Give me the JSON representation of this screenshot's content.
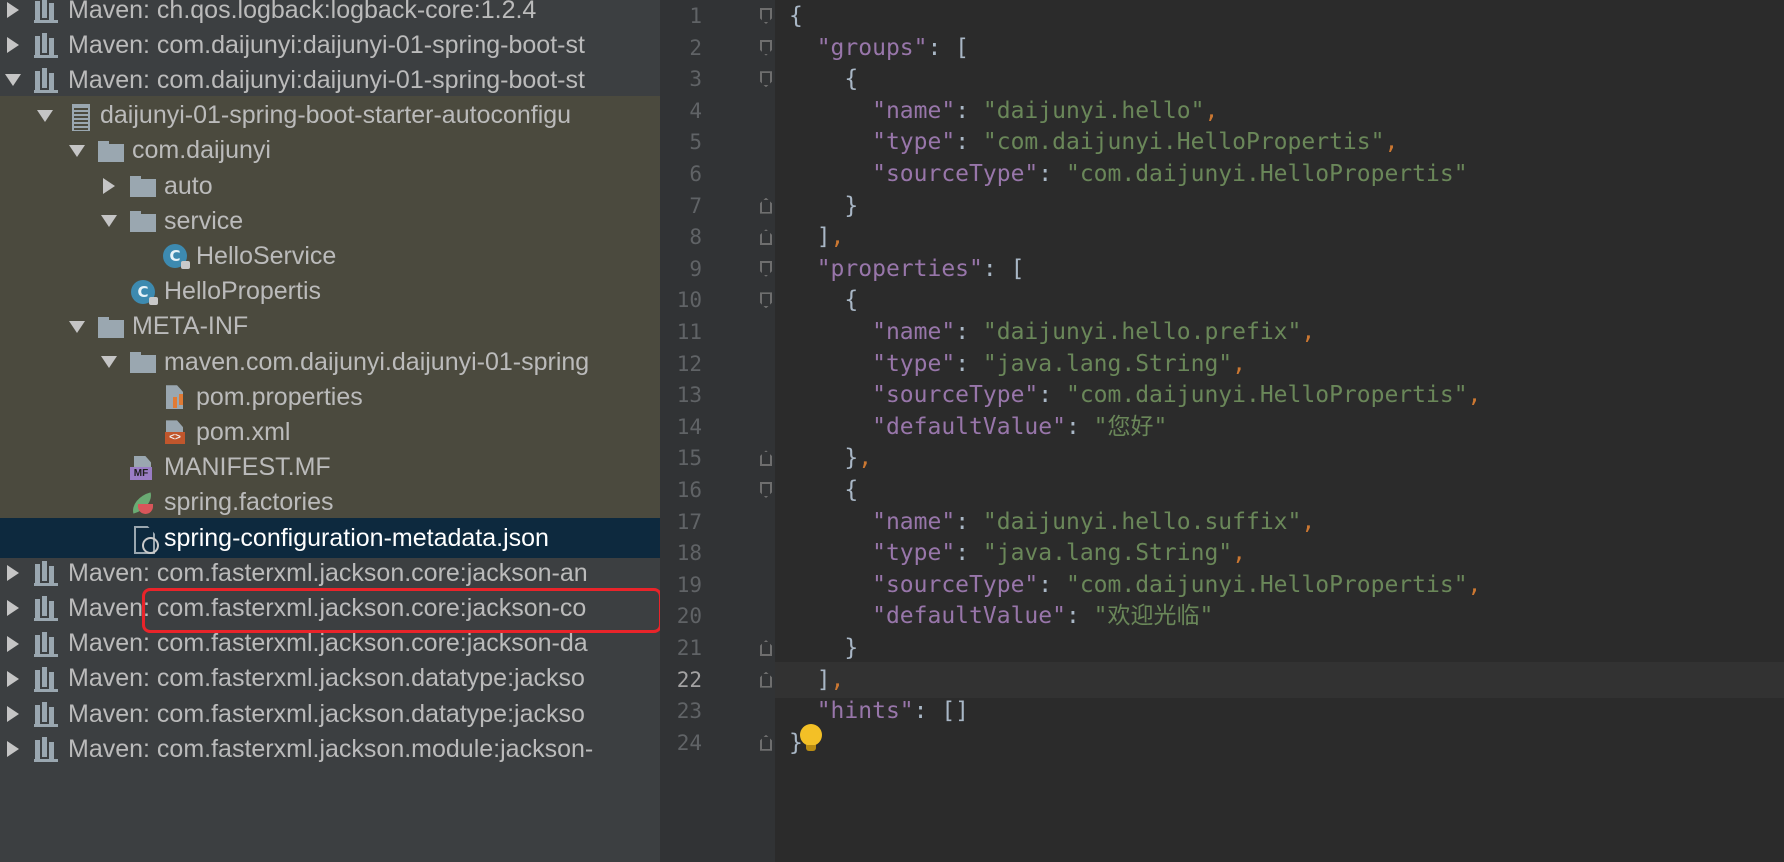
{
  "project_tree": {
    "rows": [
      {
        "label": "Maven: ch.qos.logback:logback-core:1.2.4",
        "indent": 0,
        "arrow": "right",
        "icon": "library-icon"
      },
      {
        "label": "Maven: com.daijunyi:daijunyi-01-spring-boot-st",
        "indent": 0,
        "arrow": "right",
        "icon": "library-icon"
      },
      {
        "label": "Maven: com.daijunyi:daijunyi-01-spring-boot-st",
        "indent": 0,
        "arrow": "down",
        "icon": "library-icon"
      },
      {
        "label": "daijunyi-01-spring-boot-starter-autoconfigu",
        "indent": 1,
        "arrow": "down",
        "icon": "jar-icon"
      },
      {
        "label": "com.daijunyi",
        "indent": 2,
        "arrow": "down",
        "icon": "package-icon"
      },
      {
        "label": "auto",
        "indent": 3,
        "arrow": "right",
        "icon": "package-icon"
      },
      {
        "label": "service",
        "indent": 3,
        "arrow": "down",
        "icon": "package-icon"
      },
      {
        "label": "HelloService",
        "indent": 4,
        "arrow": "none",
        "icon": "class-icon"
      },
      {
        "label": "HelloPropertis",
        "indent": 3,
        "arrow": "none",
        "icon": "class-icon"
      },
      {
        "label": "META-INF",
        "indent": 2,
        "arrow": "down",
        "icon": "folder-icon"
      },
      {
        "label": "maven.com.daijunyi.daijunyi-01-spring",
        "indent": 3,
        "arrow": "down",
        "icon": "folder-icon"
      },
      {
        "label": "pom.properties",
        "indent": 4,
        "arrow": "none",
        "icon": "properties-file-icon"
      },
      {
        "label": "pom.xml",
        "indent": 4,
        "arrow": "none",
        "icon": "xml-file-icon"
      },
      {
        "label": "MANIFEST.MF",
        "indent": 3,
        "arrow": "none",
        "icon": "manifest-file-icon"
      },
      {
        "label": "spring.factories",
        "indent": 3,
        "arrow": "none",
        "icon": "spring-file-icon"
      },
      {
        "label": "spring-configuration-metadata.json",
        "indent": 3,
        "arrow": "none",
        "icon": "json-file-icon",
        "selected": true
      },
      {
        "label": "Maven: com.fasterxml.jackson.core:jackson-an",
        "indent": 0,
        "arrow": "right",
        "icon": "library-icon"
      },
      {
        "label": "Maven: com.fasterxml.jackson.core:jackson-co",
        "indent": 0,
        "arrow": "right",
        "icon": "library-icon"
      },
      {
        "label": "Maven: com.fasterxml.jackson.core:jackson-da",
        "indent": 0,
        "arrow": "right",
        "icon": "library-icon"
      },
      {
        "label": "Maven: com.fasterxml.jackson.datatype:jackso",
        "indent": 0,
        "arrow": "right",
        "icon": "library-icon"
      },
      {
        "label": "Maven: com.fasterxml.jackson.datatype:jackso",
        "indent": 0,
        "arrow": "right",
        "icon": "library-icon"
      },
      {
        "label": "Maven: com.fasterxml.jackson.module:jackson-",
        "indent": 0,
        "arrow": "right",
        "icon": "library-icon"
      }
    ]
  },
  "editor": {
    "current_line": 22,
    "lines": [
      {
        "n": "1",
        "fold": "open",
        "tokens": [
          {
            "t": "{",
            "c": ""
          }
        ]
      },
      {
        "n": "2",
        "fold": "open",
        "tokens": [
          {
            "t": "  ",
            "c": ""
          },
          {
            "t": "\"groups\"",
            "c": "k"
          },
          {
            "t": ": [",
            "c": ""
          }
        ]
      },
      {
        "n": "3",
        "fold": "open",
        "tokens": [
          {
            "t": "    {",
            "c": ""
          }
        ]
      },
      {
        "n": "4",
        "fold": "",
        "tokens": [
          {
            "t": "      ",
            "c": ""
          },
          {
            "t": "\"name\"",
            "c": "k"
          },
          {
            "t": ": ",
            "c": ""
          },
          {
            "t": "\"daijunyi.hello\"",
            "c": "s"
          },
          {
            "t": ",",
            "c": "p"
          }
        ]
      },
      {
        "n": "5",
        "fold": "",
        "tokens": [
          {
            "t": "      ",
            "c": ""
          },
          {
            "t": "\"type\"",
            "c": "k"
          },
          {
            "t": ": ",
            "c": ""
          },
          {
            "t": "\"com.daijunyi.HelloPropertis\"",
            "c": "s"
          },
          {
            "t": ",",
            "c": "p"
          }
        ]
      },
      {
        "n": "6",
        "fold": "",
        "tokens": [
          {
            "t": "      ",
            "c": ""
          },
          {
            "t": "\"sourceType\"",
            "c": "k"
          },
          {
            "t": ": ",
            "c": ""
          },
          {
            "t": "\"com.daijunyi.HelloPropertis\"",
            "c": "s"
          }
        ]
      },
      {
        "n": "7",
        "fold": "close",
        "tokens": [
          {
            "t": "    }",
            "c": ""
          }
        ]
      },
      {
        "n": "8",
        "fold": "close",
        "tokens": [
          {
            "t": "  ]",
            "c": ""
          },
          {
            "t": ",",
            "c": "p"
          }
        ]
      },
      {
        "n": "9",
        "fold": "open",
        "tokens": [
          {
            "t": "  ",
            "c": ""
          },
          {
            "t": "\"properties\"",
            "c": "k"
          },
          {
            "t": ": [",
            "c": ""
          }
        ]
      },
      {
        "n": "10",
        "fold": "open",
        "tokens": [
          {
            "t": "    {",
            "c": ""
          }
        ]
      },
      {
        "n": "11",
        "fold": "",
        "tokens": [
          {
            "t": "      ",
            "c": ""
          },
          {
            "t": "\"name\"",
            "c": "k"
          },
          {
            "t": ": ",
            "c": ""
          },
          {
            "t": "\"daijunyi.hello.prefix\"",
            "c": "s"
          },
          {
            "t": ",",
            "c": "p"
          }
        ]
      },
      {
        "n": "12",
        "fold": "",
        "tokens": [
          {
            "t": "      ",
            "c": ""
          },
          {
            "t": "\"type\"",
            "c": "k"
          },
          {
            "t": ": ",
            "c": ""
          },
          {
            "t": "\"java.lang.String\"",
            "c": "s"
          },
          {
            "t": ",",
            "c": "p"
          }
        ]
      },
      {
        "n": "13",
        "fold": "",
        "tokens": [
          {
            "t": "      ",
            "c": ""
          },
          {
            "t": "\"sourceType\"",
            "c": "k"
          },
          {
            "t": ": ",
            "c": ""
          },
          {
            "t": "\"com.daijunyi.HelloPropertis\"",
            "c": "s"
          },
          {
            "t": ",",
            "c": "p"
          }
        ]
      },
      {
        "n": "14",
        "fold": "",
        "tokens": [
          {
            "t": "      ",
            "c": ""
          },
          {
            "t": "\"defaultValue\"",
            "c": "k"
          },
          {
            "t": ": ",
            "c": ""
          },
          {
            "t": "\"您好\"",
            "c": "s"
          }
        ]
      },
      {
        "n": "15",
        "fold": "close",
        "tokens": [
          {
            "t": "    }",
            "c": ""
          },
          {
            "t": ",",
            "c": "p"
          }
        ]
      },
      {
        "n": "16",
        "fold": "open",
        "tokens": [
          {
            "t": "    {",
            "c": ""
          }
        ]
      },
      {
        "n": "17",
        "fold": "",
        "tokens": [
          {
            "t": "      ",
            "c": ""
          },
          {
            "t": "\"name\"",
            "c": "k"
          },
          {
            "t": ": ",
            "c": ""
          },
          {
            "t": "\"daijunyi.hello.suffix\"",
            "c": "s"
          },
          {
            "t": ",",
            "c": "p"
          }
        ]
      },
      {
        "n": "18",
        "fold": "",
        "tokens": [
          {
            "t": "      ",
            "c": ""
          },
          {
            "t": "\"type\"",
            "c": "k"
          },
          {
            "t": ": ",
            "c": ""
          },
          {
            "t": "\"java.lang.String\"",
            "c": "s"
          },
          {
            "t": ",",
            "c": "p"
          }
        ]
      },
      {
        "n": "19",
        "fold": "",
        "tokens": [
          {
            "t": "      ",
            "c": ""
          },
          {
            "t": "\"sourceType\"",
            "c": "k"
          },
          {
            "t": ": ",
            "c": ""
          },
          {
            "t": "\"com.daijunyi.HelloPropertis\"",
            "c": "s"
          },
          {
            "t": ",",
            "c": "p"
          }
        ]
      },
      {
        "n": "20",
        "fold": "",
        "tokens": [
          {
            "t": "      ",
            "c": ""
          },
          {
            "t": "\"defaultValue\"",
            "c": "k"
          },
          {
            "t": ": ",
            "c": ""
          },
          {
            "t": "\"欢迎光临\"",
            "c": "s"
          }
        ]
      },
      {
        "n": "21",
        "fold": "close",
        "tokens": [
          {
            "t": "    }",
            "c": ""
          }
        ]
      },
      {
        "n": "22",
        "fold": "close",
        "tokens": [
          {
            "t": "  ]",
            "c": ""
          },
          {
            "t": ",",
            "c": "p"
          }
        ]
      },
      {
        "n": "23",
        "fold": "",
        "tokens": [
          {
            "t": "  ",
            "c": ""
          },
          {
            "t": "\"hints\"",
            "c": "k"
          },
          {
            "t": ": []",
            "c": ""
          }
        ]
      },
      {
        "n": "24",
        "fold": "close",
        "tokens": [
          {
            "t": "}",
            "c": ""
          }
        ]
      }
    ]
  },
  "colors": {
    "tree_background": "#3c3f41",
    "scope_highlight": "#4b4a3e",
    "selection": "#0d293e",
    "selection_frame": "#e9242a",
    "editor_background": "#2b2b2b",
    "json_key": "#9876aa",
    "json_string": "#6a8759",
    "json_comma": "#cc7832"
  }
}
